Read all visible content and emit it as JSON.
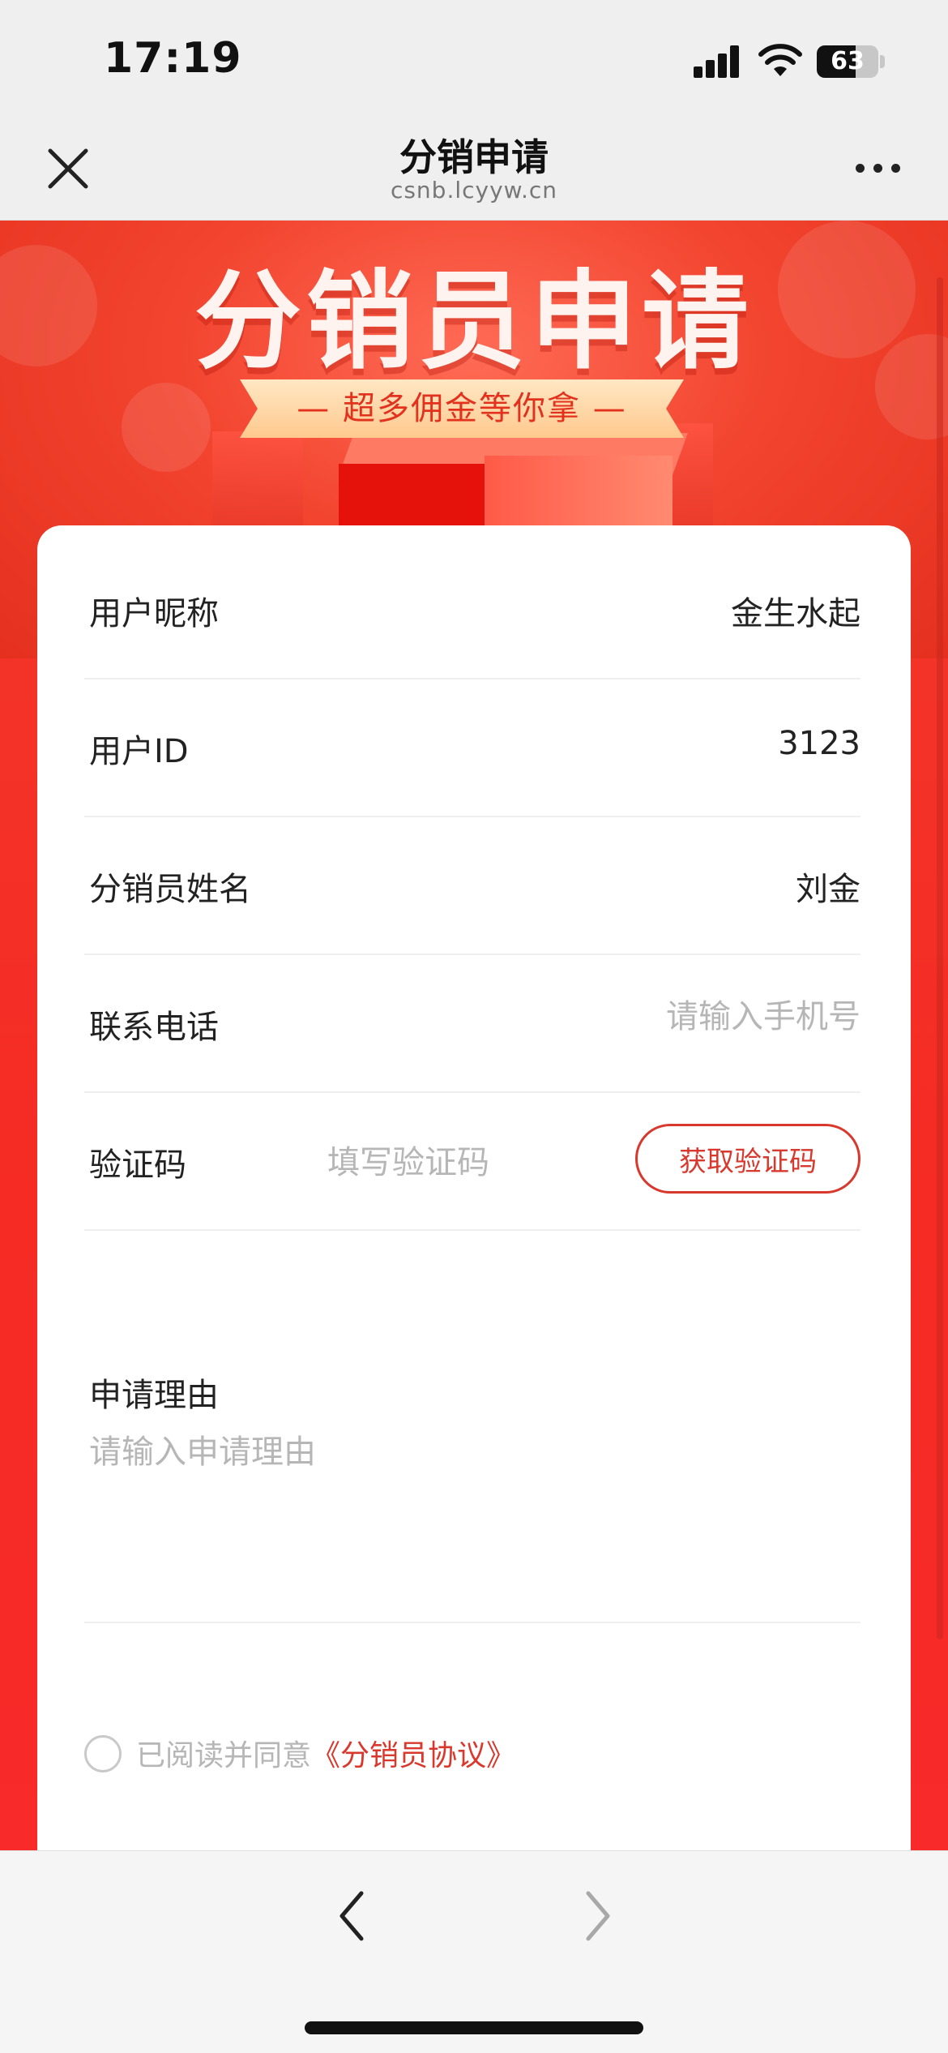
{
  "status_bar": {
    "time": "17:19",
    "battery": "63",
    "battery_level": 0.63
  },
  "nav": {
    "title": "分销申请",
    "url": "csnb.lcyyw.cn"
  },
  "banner": {
    "title": "分销员申请",
    "ribbon": "— 超多佣金等你拿 —"
  },
  "form": {
    "nickname": {
      "label": "用户昵称",
      "value": "金生水起"
    },
    "user_id": {
      "label": "用户ID",
      "value": "3123"
    },
    "name": {
      "label": "分销员姓名",
      "value": "刘金"
    },
    "phone": {
      "label": "联系电话",
      "placeholder": "请输入手机号"
    },
    "code": {
      "label": "验证码",
      "placeholder": "填写验证码",
      "button": "获取验证码"
    },
    "reason": {
      "label": "申请理由",
      "placeholder": "请输入申请理由"
    },
    "agreement": {
      "text": "已阅读并同意",
      "link": "《分销员协议》",
      "checked": false
    }
  },
  "icons": {
    "close": "close-icon",
    "more": "more-icon",
    "back": "chevron-left-icon",
    "forward": "chevron-right-icon",
    "signal": "signal-icon",
    "wifi": "wifi-icon",
    "battery": "battery-icon"
  },
  "colors": {
    "accent": "#d9382d",
    "banner": "#f2442f",
    "placeholder": "#b6b6b6"
  }
}
